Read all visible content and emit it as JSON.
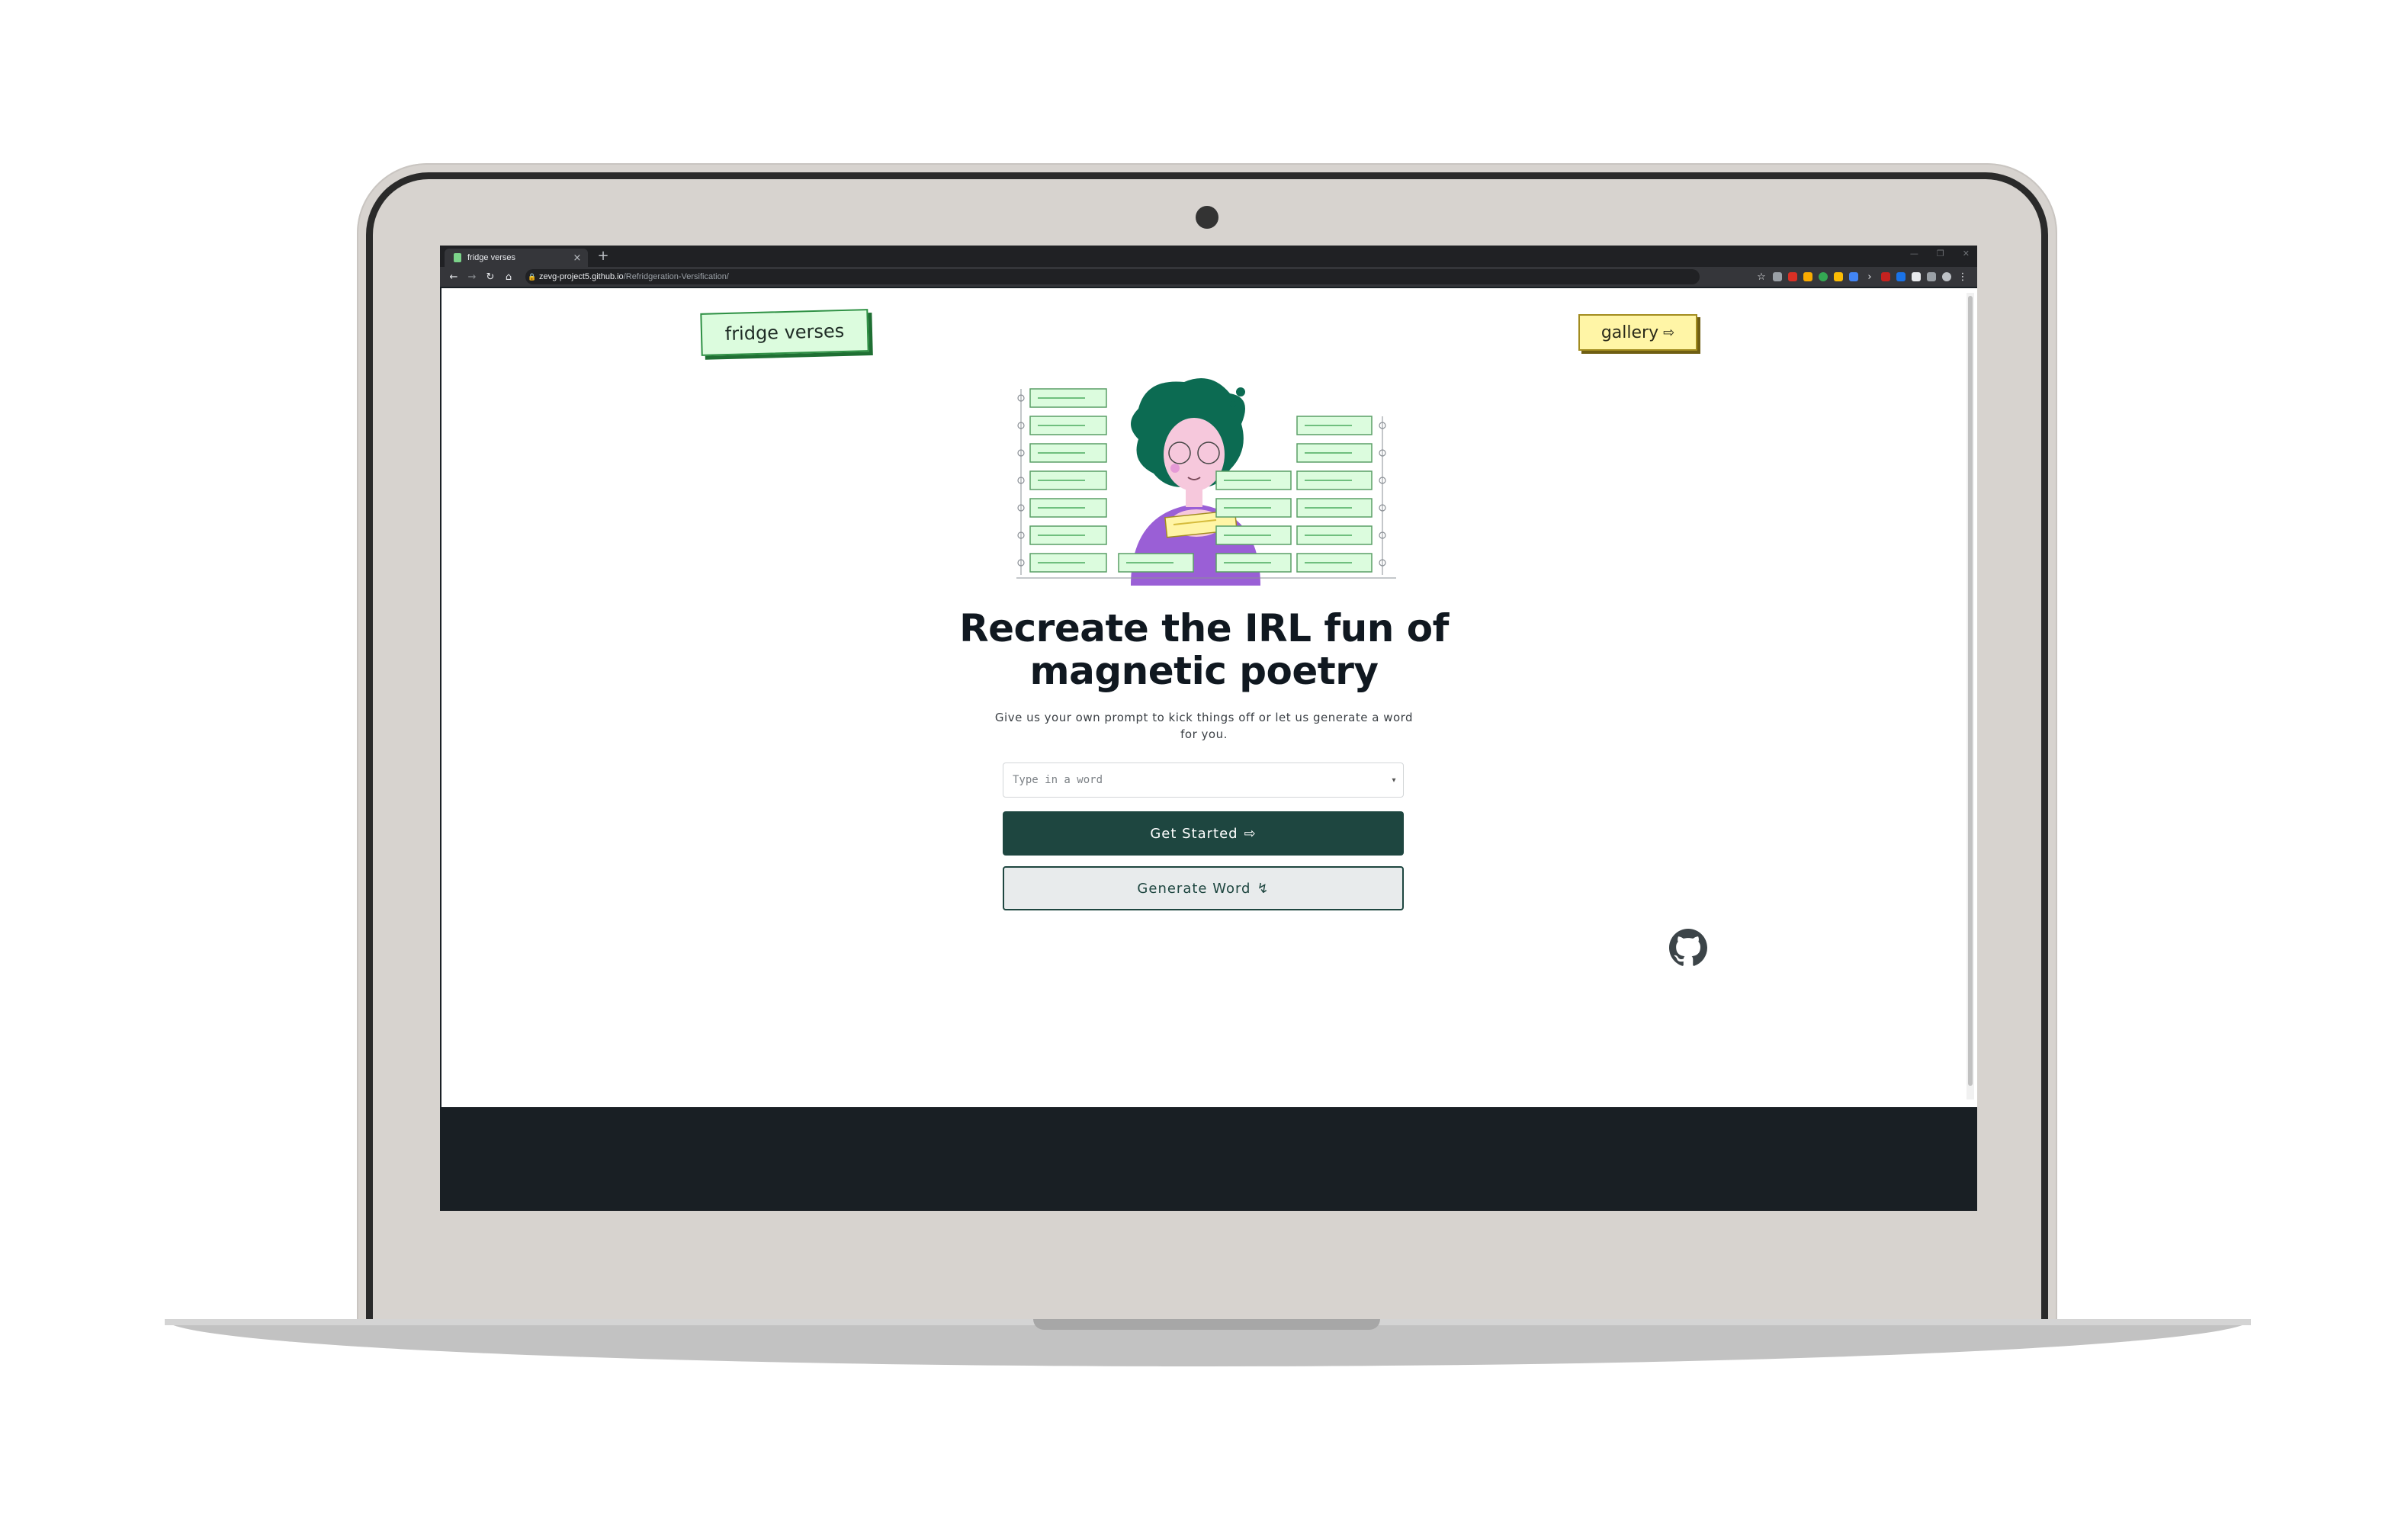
{
  "browser": {
    "tab_title": "fridge verses",
    "url_host": "zevg-project5.github.io",
    "url_path": "/Refridgeration-Versification/",
    "new_tab_label": "+",
    "close_label": "×"
  },
  "page": {
    "logo_label": "fridge verses",
    "gallery_label": "gallery",
    "headline_line1": "Recreate the IRL fun of",
    "headline_line2": "magnetic poetry",
    "subtext": "Give us your own prompt to kick things off or let us generate a word for you.",
    "input_placeholder": "Type in a word",
    "get_started_label": "Get Started",
    "generate_word_label": "Generate Word"
  },
  "colors": {
    "primary": "#1e4640",
    "logo_bg": "#dcfcde",
    "gallery_bg": "#fff5a6",
    "hair": "#0c6b52",
    "shirt": "#9a5fd6"
  }
}
